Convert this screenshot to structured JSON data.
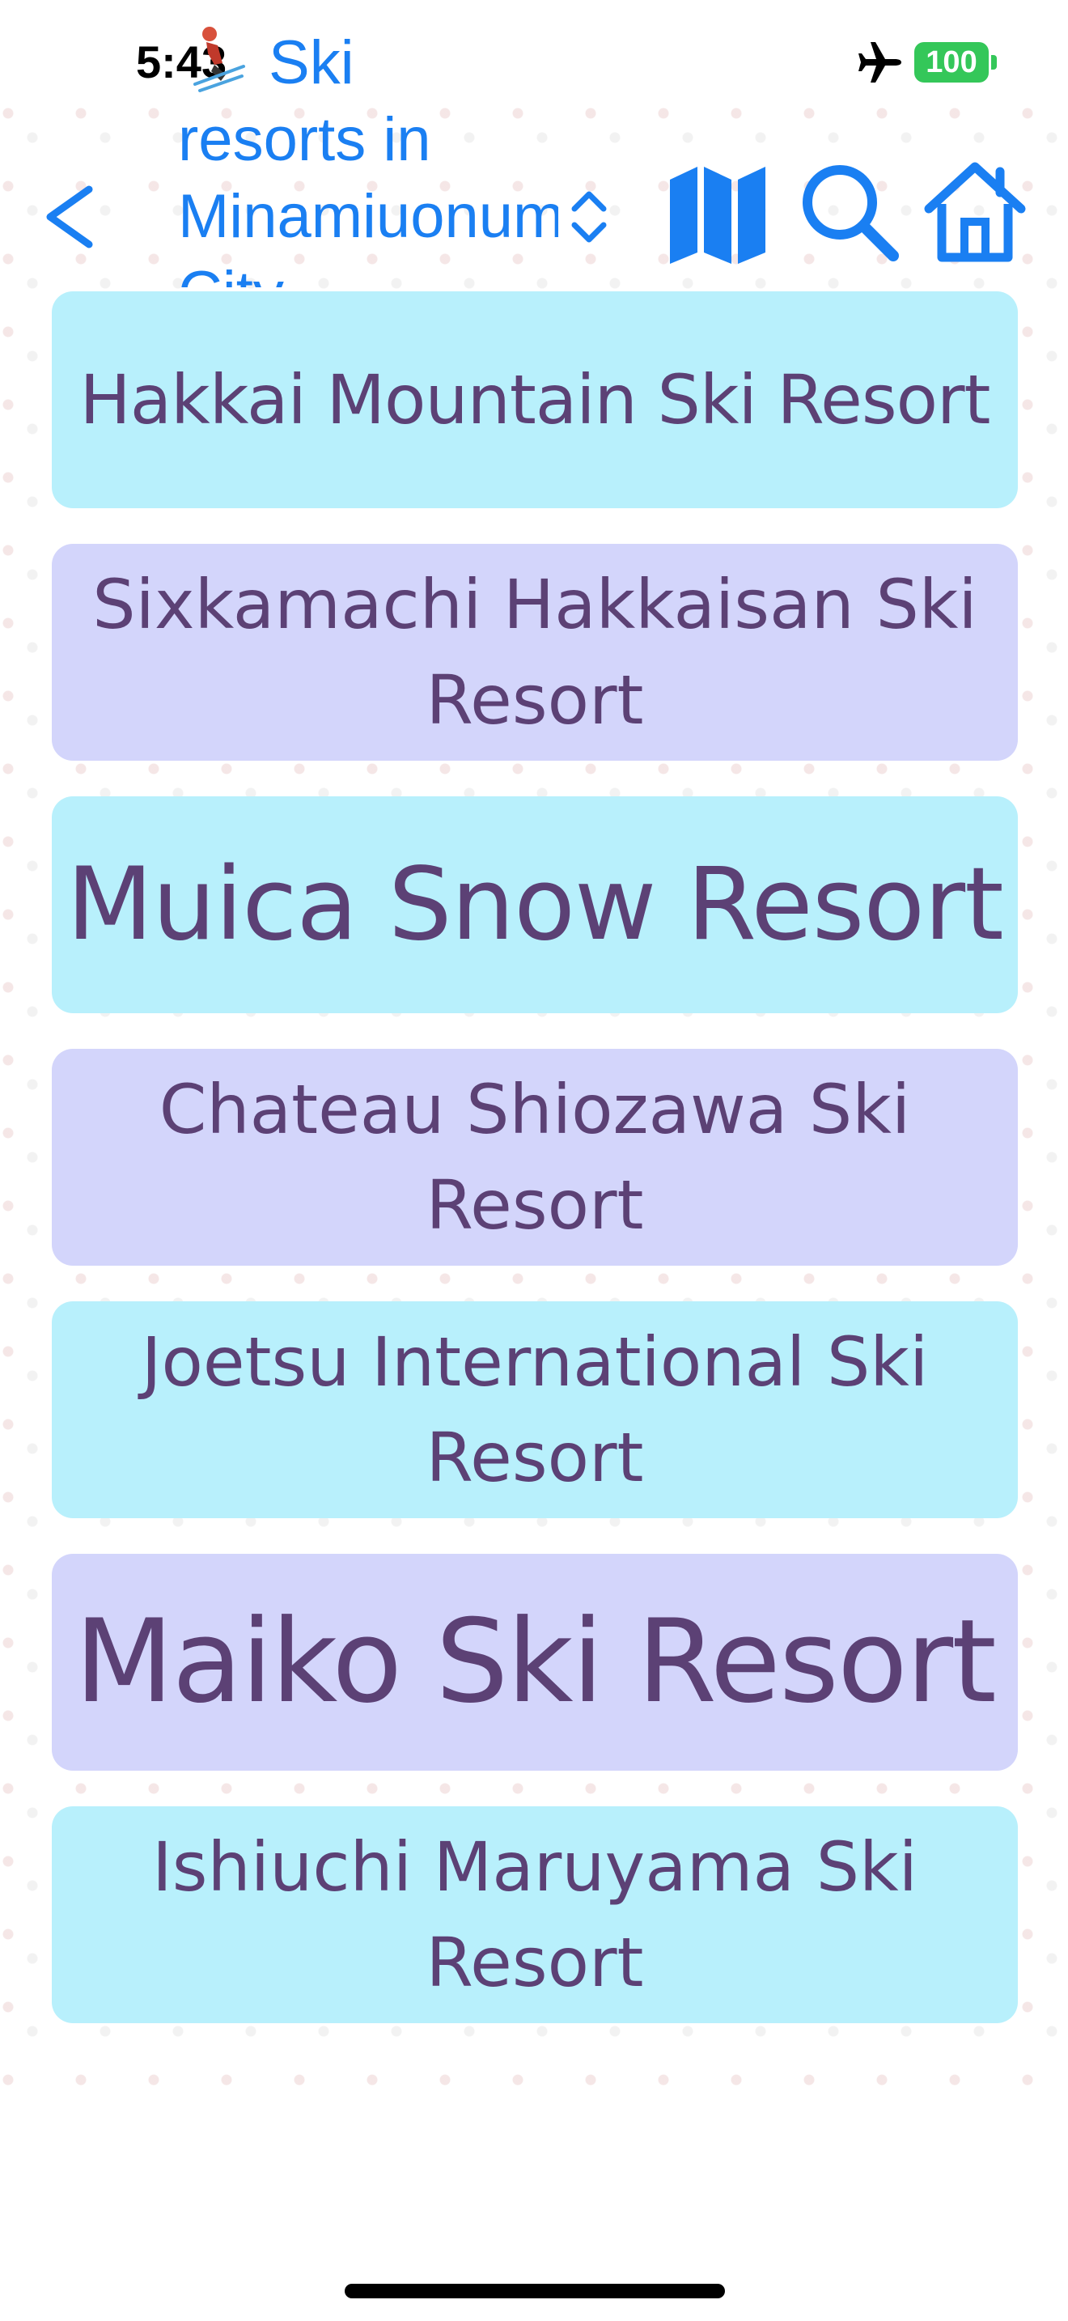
{
  "status_bar": {
    "time": "5:43",
    "battery": "100",
    "icons": {
      "overlay": "skier-icon",
      "airplane": "airplane-icon"
    },
    "battery_color": "#34c759"
  },
  "nav": {
    "title": "Ski resorts in Minamiuonuma City",
    "back_icon": "chevron-left-icon",
    "sort_icon": "chevron-up-down-icon",
    "map_icon": "map-icon",
    "search_icon": "search-icon",
    "home_icon": "home-icon",
    "accent_color": "#1a7ff2"
  },
  "resorts": [
    {
      "name": "Hakkai Mountain Ski Resort"
    },
    {
      "name": "Sixkamachi Hakkaisan Ski Resort"
    },
    {
      "name": "Muica Snow Resort"
    },
    {
      "name": "Chateau Shiozawa Ski Resort"
    },
    {
      "name": "Joetsu International Ski Resort"
    },
    {
      "name": "Maiko Ski Resort"
    },
    {
      "name": "Ishiuchi Maruyama Ski Resort"
    }
  ],
  "colors": {
    "item_cyan": "#b8f0fc",
    "item_lavender": "#d3d5fb",
    "item_text": "#5c4175"
  }
}
